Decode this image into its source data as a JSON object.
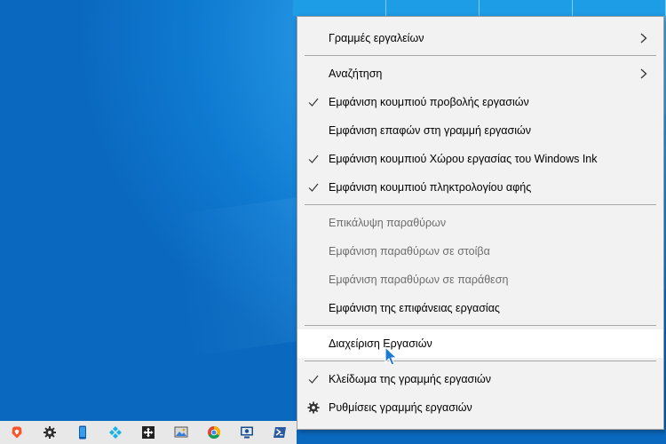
{
  "context_menu": {
    "items": [
      {
        "label": "Γραμμές εργαλείων",
        "submenu": true
      },
      {
        "label": "Αναζήτηση",
        "submenu": true
      },
      {
        "label": "Εμφάνιση κουμπιού προβολής εργασιών",
        "checked": true
      },
      {
        "label": "Εμφάνιση επαφών στη γραμμή εργασιών",
        "checked": false
      },
      {
        "label": "Εμφάνιση κουμπιού Χώρου εργασίας του Windows Ink",
        "checked": true
      },
      {
        "label": "Εμφάνιση κουμπιού πληκτρολογίου αφής",
        "checked": true
      },
      {
        "label": "Επικάλυψη παραθύρων",
        "disabled": true
      },
      {
        "label": "Εμφάνιση παραθύρων σε στοίβα",
        "disabled": true
      },
      {
        "label": "Εμφάνιση παραθύρων σε παράθεση",
        "disabled": true
      },
      {
        "label": "Εμφάνιση της επιφάνειας εργασίας"
      },
      {
        "label": "Διαχείριση Εργασιών",
        "highlighted": true
      },
      {
        "label": "Κλείδωμα της γραμμής εργασιών",
        "checked": true
      },
      {
        "label": "Ρυθμίσεις γραμμής εργασιών",
        "icon": "gear-icon"
      }
    ]
  },
  "taskbar": {
    "icons": [
      "brave-browser-icon",
      "settings-gear-icon",
      "phone-app-icon",
      "kodi-icon",
      "move-tool-icon",
      "image-viewer-icon",
      "chrome-icon",
      "remote-desktop-icon",
      "powershell-icon"
    ]
  },
  "colors": {
    "menu_background": "#f2f2f2",
    "menu_highlight": "#ffffff",
    "disabled_text": "#6d6d6d",
    "desktop_blue": "#0f7ad1",
    "taskbar": "#e8e8e8"
  }
}
